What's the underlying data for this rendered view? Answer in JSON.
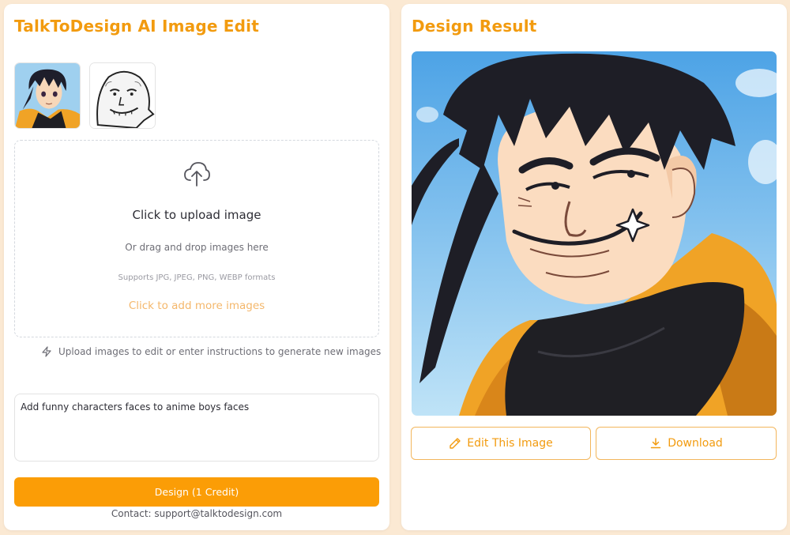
{
  "left_panel": {
    "title": "TalkToDesign AI Image Edit",
    "thumbnails": [
      {
        "icon": "anime-boy-thumbnail"
      },
      {
        "icon": "meme-face-thumbnail"
      }
    ],
    "upload": {
      "icon": "cloud-upload-icon",
      "title": "Click to upload image",
      "subtitle": "Or drag and drop images here",
      "formats": "Supports JPG, JPEG, PNG, WEBP formats",
      "add_more": "Click to add more images"
    },
    "hint": {
      "icon": "lightning-icon",
      "text": "Upload images to edit or enter instructions to generate new images"
    },
    "prompt": {
      "value": "Add funny characters faces to anime boys faces"
    },
    "design_button": "Design (1 Credit)",
    "contact": "Contact: support@talktodesign.com"
  },
  "right_panel": {
    "title": "Design Result",
    "edit_button": "Edit This Image",
    "download_button": "Download"
  },
  "colors": {
    "accent": "#f29b0f",
    "button_bg": "#fb9d06",
    "page_bg": "#fbe9d3",
    "outline": "#f3b65c"
  }
}
